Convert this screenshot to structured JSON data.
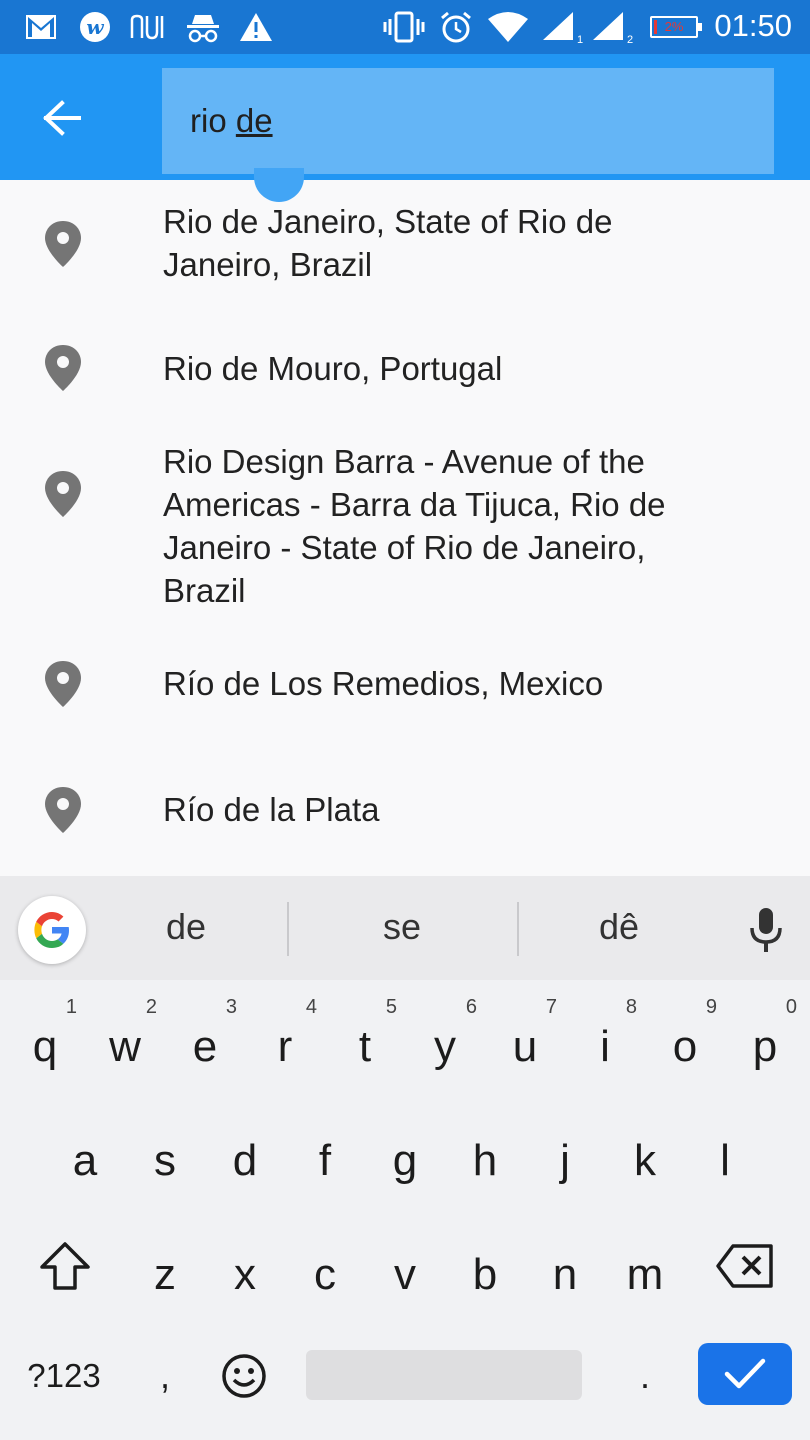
{
  "status_bar": {
    "time": "01:50",
    "battery_percent": "2%",
    "left_icons": [
      "gmail-icon",
      "w-app-icon",
      "nu-app-icon",
      "incognito-icon",
      "warning-icon"
    ],
    "right_icons": [
      "vibrate-icon",
      "alarm-icon",
      "wifi-icon",
      "signal-1-icon",
      "signal-2-icon",
      "battery-icon"
    ],
    "sim1_label": "1",
    "sim2_label": "2"
  },
  "app_bar": {
    "back_icon": "arrow-back-icon",
    "search": {
      "text_prefix": "rio ",
      "text_composing": "de"
    },
    "colors": {
      "bar": "#2196f3",
      "field": "#64b5f6"
    }
  },
  "results": [
    {
      "icon": "location-pin-icon",
      "lines": [
        "Rio de Janeiro, State of Rio de",
        "Janeiro, Brazil"
      ]
    },
    {
      "icon": "location-pin-icon",
      "lines": [
        "Rio de Mouro, Portugal"
      ]
    },
    {
      "icon": "location-pin-icon",
      "lines": [
        "Rio Design Barra - Avenue of the",
        "Americas - Barra da Tijuca, Rio de",
        "Janeiro - State of Rio de Janeiro,",
        "Brazil"
      ]
    },
    {
      "icon": "location-pin-icon",
      "lines": [
        "Río de Los Remedios, Mexico"
      ]
    },
    {
      "icon": "location-pin-icon",
      "lines": [
        "Río de la Plata"
      ]
    }
  ],
  "keyboard": {
    "suggestions": [
      "de",
      "se",
      "dê"
    ],
    "row1": [
      {
        "key": "q",
        "hint": "1"
      },
      {
        "key": "w",
        "hint": "2"
      },
      {
        "key": "e",
        "hint": "3"
      },
      {
        "key": "r",
        "hint": "4"
      },
      {
        "key": "t",
        "hint": "5"
      },
      {
        "key": "y",
        "hint": "6"
      },
      {
        "key": "u",
        "hint": "7"
      },
      {
        "key": "i",
        "hint": "8"
      },
      {
        "key": "o",
        "hint": "9"
      },
      {
        "key": "p",
        "hint": "0"
      }
    ],
    "row2": [
      "a",
      "s",
      "d",
      "f",
      "g",
      "h",
      "j",
      "k",
      "l"
    ],
    "row3": [
      "z",
      "x",
      "c",
      "v",
      "b",
      "n",
      "m"
    ],
    "symbols_label": "?123",
    "comma_label": ",",
    "period_label": ".",
    "enter_color": "#1a73e8"
  }
}
